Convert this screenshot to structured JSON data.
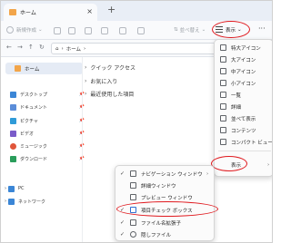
{
  "tab": {
    "title": "ホーム",
    "close": "×"
  },
  "newtab": "+",
  "toolbar": {
    "new_label": "新規作成",
    "sort_label": "並べ替え",
    "view_label": "表示",
    "more": "···"
  },
  "address": {
    "path": "ホーム",
    "sep": "›",
    "path_root": "⌂"
  },
  "nav": {
    "back": "←",
    "forward": "→",
    "up": "↑",
    "refresh": "↻"
  },
  "sidebar": {
    "home": "ホーム",
    "items": [
      {
        "label": "デスクトップ",
        "pin": "📌",
        "color": "#3b86d6"
      },
      {
        "label": "ドキュメント",
        "pin": "📌",
        "color": "#5b8dd9"
      },
      {
        "label": "ピクチャ",
        "pin": "📌",
        "color": "#2f9bd8"
      },
      {
        "label": "ビデオ",
        "pin": "📌",
        "color": "#7a5cc9"
      },
      {
        "label": "ミュージック",
        "pin": "📌",
        "color": "#e0553a"
      },
      {
        "label": "ダウンロード",
        "pin": "📌",
        "color": "#2a9d5b"
      }
    ],
    "pc": "PC",
    "network": "ネットワーク"
  },
  "content": {
    "items": [
      "クイック アクセス",
      "お気に入り",
      "最近使用した項目"
    ]
  },
  "view_menu": {
    "items": [
      "特大アイコン",
      "大アイコン",
      "中アイコン",
      "小アイコン",
      "一覧",
      "詳細",
      "並べて表示",
      "コンテンツ",
      "コンパクト ビュー"
    ],
    "show_label": "表示",
    "show_arrow": "›"
  },
  "show_submenu": {
    "items": [
      {
        "label": "ナビゲーション ウィンドウ",
        "checked": true
      },
      {
        "label": "詳細ウィンドウ",
        "checked": false
      },
      {
        "label": "プレビュー ウィンドウ",
        "checked": false
      },
      {
        "label": "項目チェック ボックス",
        "checked": true
      },
      {
        "label": "ファイル名拡張子",
        "checked": true
      },
      {
        "label": "隠しファイル",
        "checked": true
      }
    ],
    "check_glyph": "✓",
    "arrow": "›"
  },
  "colors": {
    "highlight": "#e0191e",
    "folder": "#f2c14e"
  }
}
